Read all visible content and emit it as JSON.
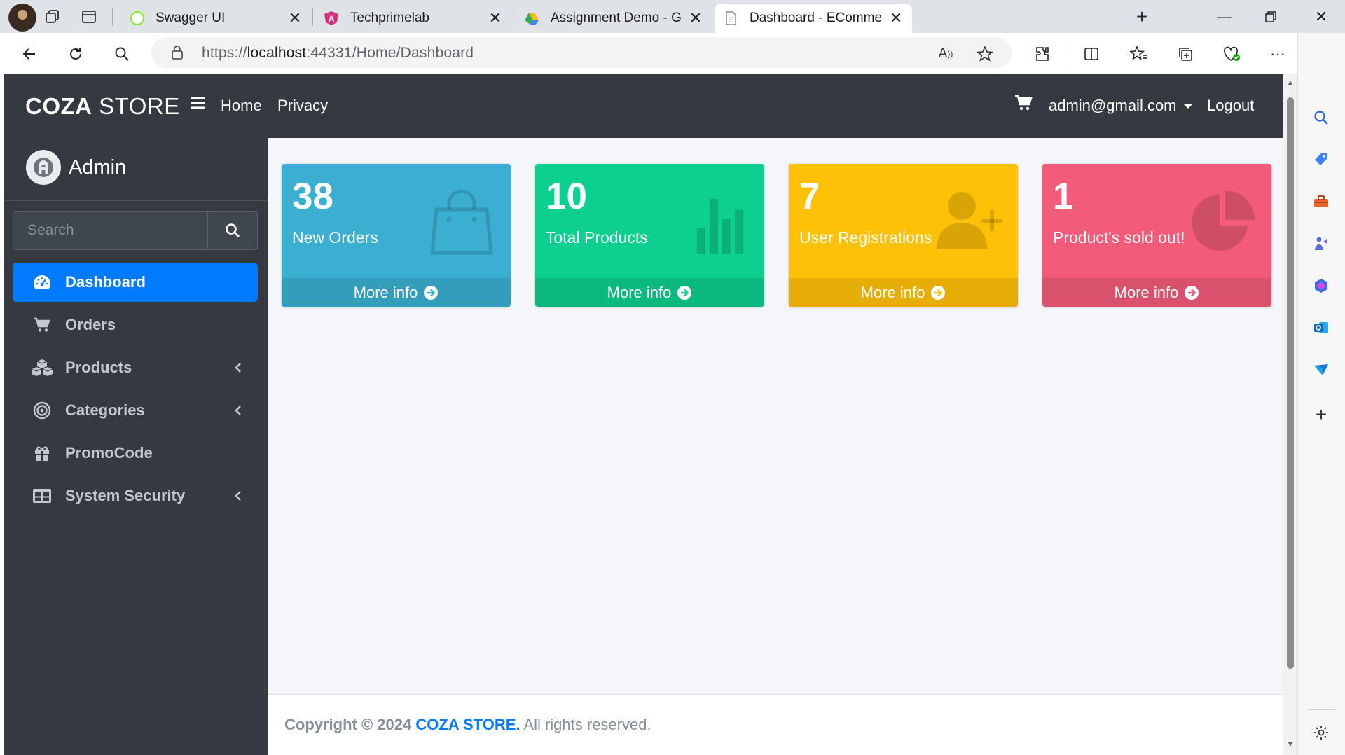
{
  "browser": {
    "tabs": [
      {
        "title": "Swagger UI",
        "favicon": "swagger-icon",
        "active": false
      },
      {
        "title": "Techprimelab",
        "favicon": "angular-icon",
        "active": false
      },
      {
        "title": "Assignment Demo - Google Dri",
        "favicon": "google-drive-icon",
        "active": false
      },
      {
        "title": "Dashboard - ECommerceProject",
        "favicon": "document-icon",
        "active": true
      }
    ],
    "url_prefix": "https://",
    "url_host": "localhost",
    "url_rest": ":44331/Home/Dashboard"
  },
  "navbar": {
    "brand_bold": "COZA",
    "brand_rest": " STORE",
    "links": [
      "Home",
      "Privacy"
    ],
    "user_email": "admin@gmail.com",
    "logout": "Logout"
  },
  "sidebar": {
    "user_name": "Admin",
    "search_placeholder": "Search",
    "items": [
      {
        "label": "Dashboard",
        "icon": "tachometer-icon",
        "active": true,
        "has_children": false
      },
      {
        "label": "Orders",
        "icon": "cart-icon",
        "active": false,
        "has_children": false
      },
      {
        "label": "Products",
        "icon": "cubes-icon",
        "active": false,
        "has_children": true
      },
      {
        "label": "Categories",
        "icon": "bullseye-icon",
        "active": false,
        "has_children": true
      },
      {
        "label": "PromoCode",
        "icon": "gift-icon",
        "active": false,
        "has_children": false
      },
      {
        "label": "System Security",
        "icon": "table-icon",
        "active": false,
        "has_children": true
      }
    ]
  },
  "stats": [
    {
      "value": "38",
      "label": "New Orders",
      "icon": "shopping-bag-icon",
      "color": "#17a2b8",
      "more": "More info"
    },
    {
      "value": "10",
      "label": "Total Products",
      "icon": "bar-chart-icon",
      "color": "#0dcf8e",
      "more": "More info"
    },
    {
      "value": "7",
      "label": "User Registrations",
      "icon": "user-plus-icon",
      "color": "#ffc107",
      "more": "More info"
    },
    {
      "value": "1",
      "label": "Product's sold out!",
      "icon": "pie-chart-icon",
      "color": "#f25b7a",
      "more": "More info"
    }
  ],
  "footer": {
    "copyright": "Copyright © 2024 ",
    "brand": "COZA STORE.",
    "rights": " All rights reserved."
  },
  "colors": {
    "navbar_bg": "#343a40",
    "sidebar_bg": "#343a40",
    "active_item": "#007bff",
    "content_bg": "#f4f6f9"
  }
}
